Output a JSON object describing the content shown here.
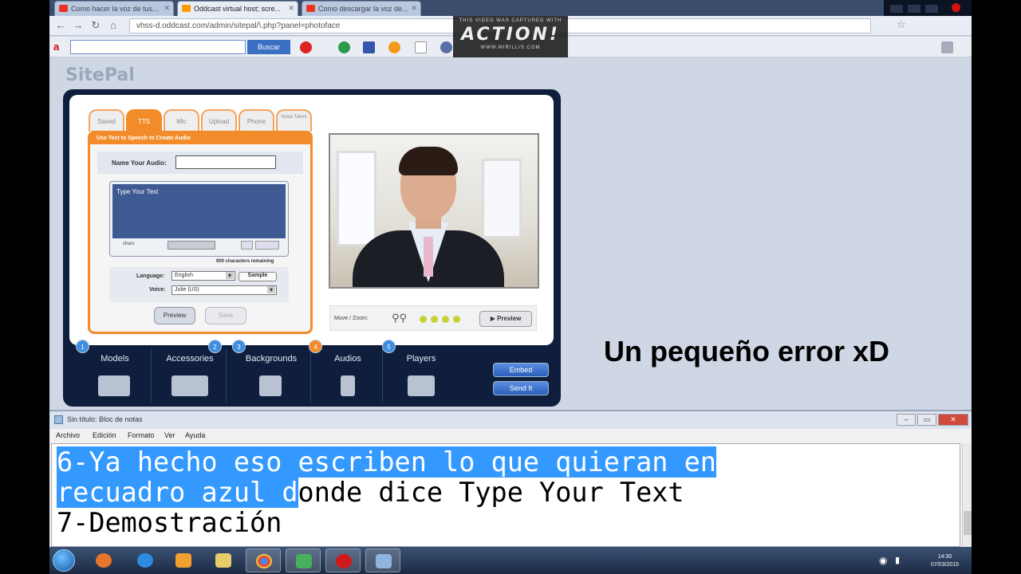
{
  "browser": {
    "tabs": [
      {
        "title": "Como hacer la voz de tus..."
      },
      {
        "title": "Oddcast virtual host; scre..."
      },
      {
        "title": "Como descargar la voz de..."
      }
    ],
    "url": "vhss-d.oddcast.com/admin/sitepal/\\.php?panel=photoface",
    "toolbar_search_button": "Buscar"
  },
  "watermark": {
    "line1": "THIS VIDEO WAS CAPTURED WITH",
    "brand": "ACTION!",
    "site": "WWW.MIRILLIS.COM"
  },
  "sitepal": {
    "logo": "SitePal",
    "tabs": [
      "Saved",
      "TTS",
      "Mic",
      "Upload",
      "Phone",
      "Voice Talent"
    ],
    "active_tab": "TTS",
    "header": "Use Text to Speech to Create Audio",
    "name_label": "Name Your Audio:",
    "type_placeholder": "Type Your Text",
    "counter_label": "chars",
    "chars_remaining": "900 characters remaining",
    "language_label": "Language:",
    "language_value": "English",
    "voice_label": "Voice:",
    "voice_value": "Julie (US)",
    "sample_button": "Sample",
    "preview_button": "Preview",
    "save_button": "Save",
    "player_label": "Move / Zoom:",
    "player_preview": "Preview",
    "nav": [
      {
        "num": "1",
        "label": "Models"
      },
      {
        "num": "2",
        "label": "Accessories"
      },
      {
        "num": "3",
        "label": "Backgrounds"
      },
      {
        "num": "4",
        "label": "Audios"
      },
      {
        "num": "5",
        "label": "Players"
      }
    ],
    "embed_button": "Embed",
    "send_button": "Send It"
  },
  "caption": "Un pequeño error xD",
  "notepad": {
    "title": "Sin título: Bloc de notas",
    "menu": [
      "Archivo",
      "Edición",
      "Formato",
      "Ver",
      "Ayuda"
    ],
    "line1": "6-Ya hecho eso escriben lo que quieran en",
    "line2_selected": "recuadro azul d",
    "line2_rest": "onde dice Type Your Text",
    "line3": "7-Demostración"
  },
  "taskbar": {
    "time": "14:30",
    "date": "07/03/2015"
  },
  "colors": {
    "sitepal_orange": "#f28c2a",
    "sitepal_navy": "#0f1e3c",
    "selection_blue": "#3399ff"
  }
}
